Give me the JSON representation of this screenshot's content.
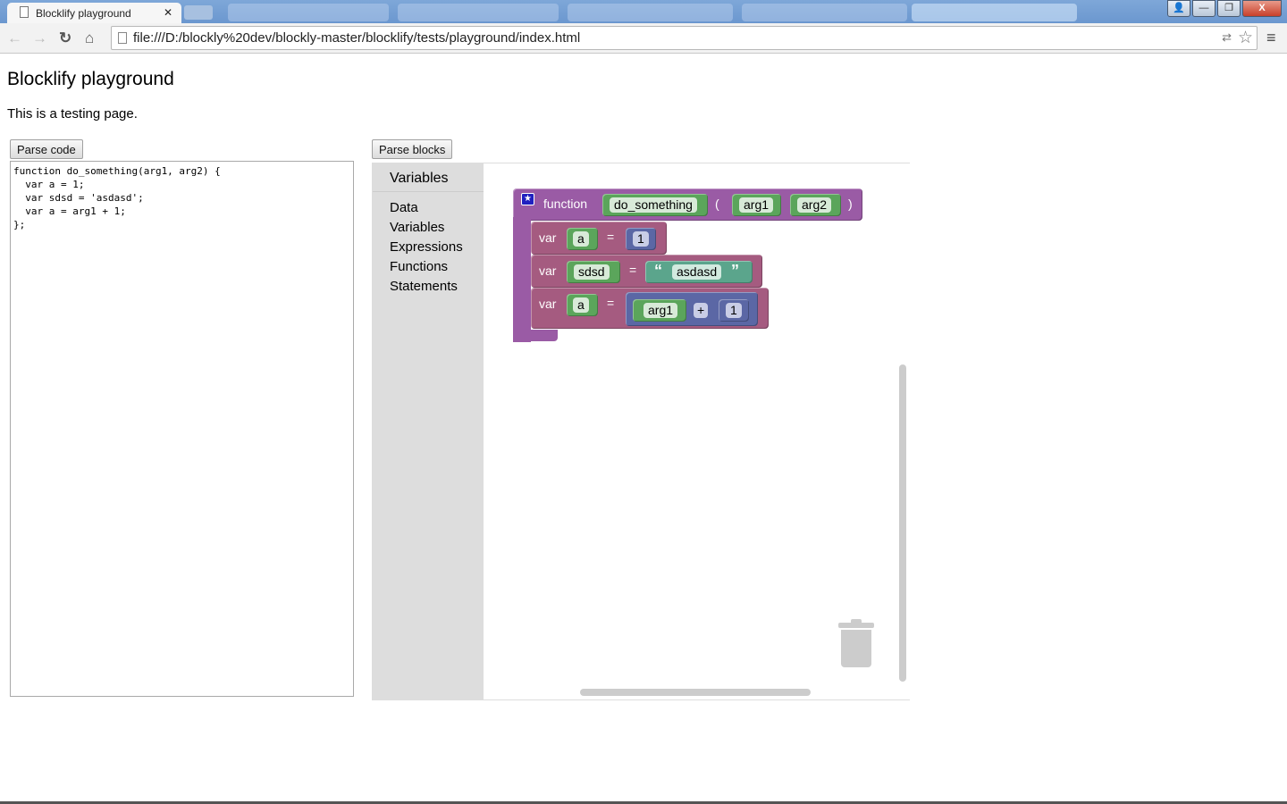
{
  "browser": {
    "tab_title": "Blocklify playground",
    "url": "file:///D:/blockly%20dev/blockly-master/blocklify/tests/playground/index.html"
  },
  "page": {
    "title": "Blocklify playground",
    "intro": "This is a testing page.",
    "parse_code_label": "Parse code",
    "parse_blocks_label": "Parse blocks",
    "code": "function do_something(arg1, arg2) {\n  var a = 1;\n  var sdsd = 'asdasd';\n  var a = arg1 + 1;\n};"
  },
  "toolbox": {
    "categories": [
      "Variables",
      "Data",
      "Variables",
      "Expressions",
      "Functions",
      "Statements"
    ]
  },
  "blocks": {
    "function_kw": "function",
    "name": "do_something",
    "open_paren": "(",
    "close_paren": ")",
    "arg1": "arg1",
    "arg2": "arg2",
    "var_kw": "var",
    "eq": "=",
    "v1": "a",
    "n1": "1",
    "v2": "sdsd",
    "s2": "asdasd",
    "open_quote": "“",
    "close_quote": "”",
    "v3": "a",
    "op_left": "arg1",
    "op": "+",
    "op_right": "1"
  },
  "colors": {
    "function": "#9a5ba5",
    "var": "#a55b80",
    "variable": "#5ba55b",
    "number": "#5b67a5",
    "string": "#5ba58c"
  }
}
